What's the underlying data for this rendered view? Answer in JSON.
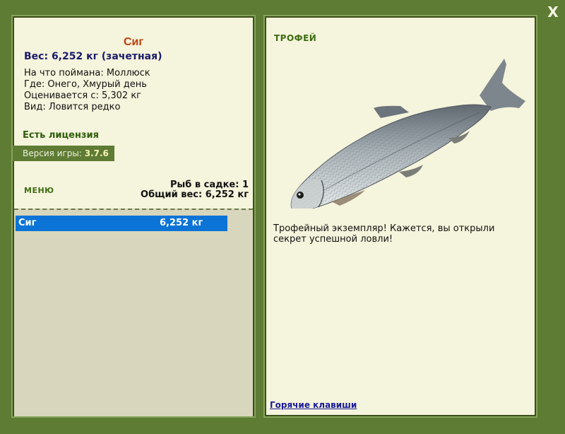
{
  "window": {
    "close_label": "X"
  },
  "fish_info": {
    "name": "Сиг",
    "weight_line": "Вес: 6,252 кг (зачетная)",
    "caught_on": "На что поймана: Моллюск",
    "location": "Где: Онего, Хмурый день",
    "valued_from": "Оценивается с: 5,302 кг",
    "kind": "Вид: Ловится редко"
  },
  "license_text": "Есть лицензия",
  "version": {
    "label": "Версия игры:",
    "value": "3.7.6"
  },
  "menu_label": "МЕНЮ",
  "cage": {
    "count_line": "Рыб в садке: 1",
    "total_line": "Общий вес: 6,252 кг",
    "items": [
      {
        "name": "Сиг",
        "weight": "6,252 кг"
      }
    ]
  },
  "trophy": {
    "title": "ТРОФЕЙ",
    "image_label": "whitefish-image",
    "text": "Трофейный экземпляр! Кажется, вы открыли секрет успешной ловли!"
  },
  "hotkeys_label": "Горячие клавиши"
}
